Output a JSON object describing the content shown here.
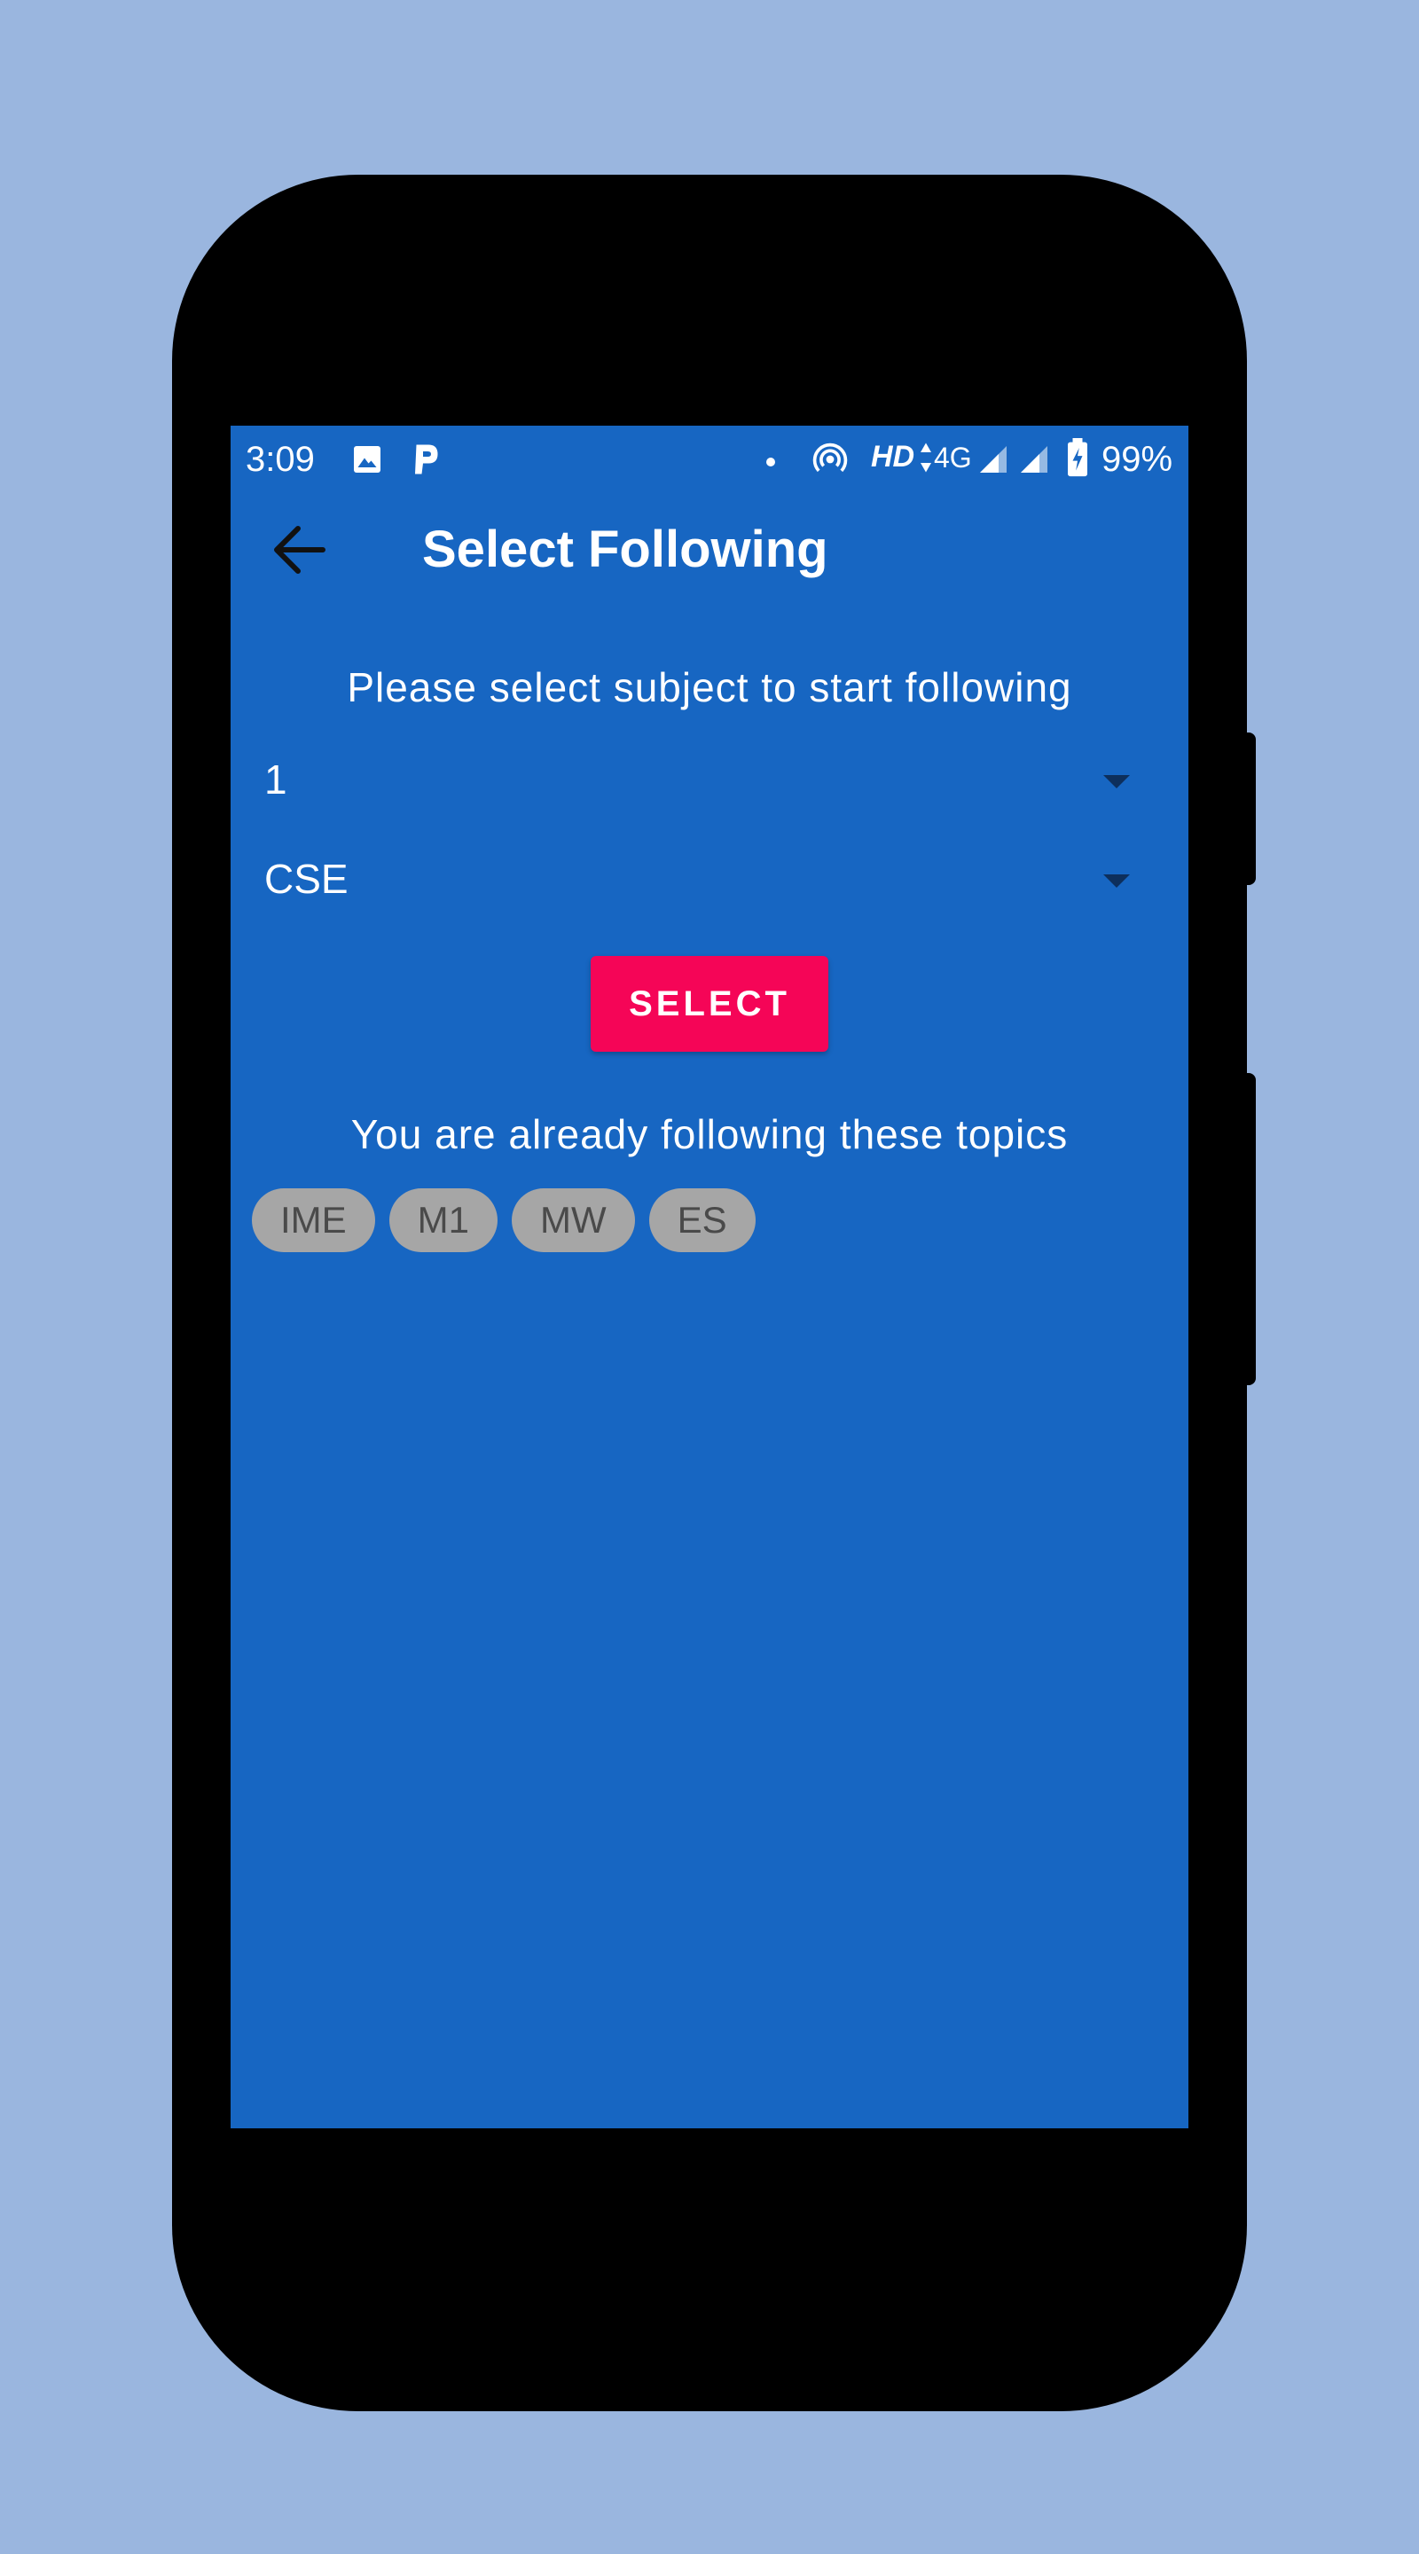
{
  "status_bar": {
    "time": "3:09",
    "network_hd": "HD",
    "network_type": "4G",
    "battery": "99%",
    "icons": [
      "image-icon",
      "parking-icon",
      "notification-dot-icon",
      "hotspot-icon",
      "signal-icon",
      "signal-icon",
      "battery-charging-icon"
    ]
  },
  "toolbar": {
    "title": "Select Following",
    "back_icon": "arrow-back-icon"
  },
  "instruction": "Please select subject to start following",
  "dropdowns": {
    "semester": {
      "value": "1"
    },
    "branch": {
      "value": "CSE"
    }
  },
  "select_button": {
    "label": "SELECT"
  },
  "following": {
    "heading": "You are already following these topics",
    "topics": [
      "IME",
      "M1",
      "MW",
      "ES"
    ]
  },
  "colors": {
    "background": "#9ab6df",
    "screen": "#1766c2",
    "accent": "#f50557",
    "chip": "#a6a6a6"
  }
}
